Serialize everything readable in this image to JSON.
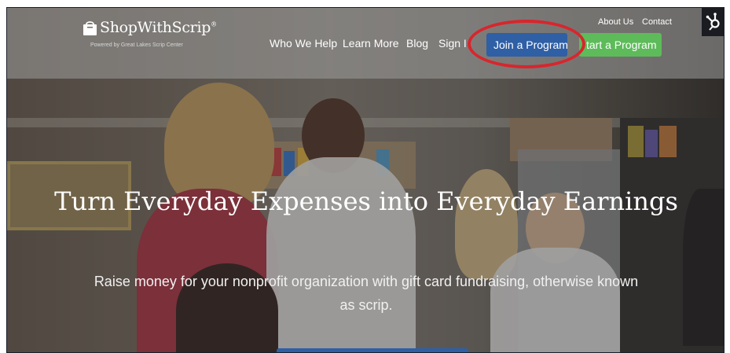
{
  "brand": {
    "name": "ShopWithScrip",
    "trademark": "®",
    "tagline": "Powered by Great Lakes Scrip Center"
  },
  "top_links": {
    "about": "About Us",
    "contact": "Contact"
  },
  "nav": {
    "who_we_help": "Who We Help",
    "learn_more": "Learn More",
    "blog": "Blog",
    "sign_in": "Sign I"
  },
  "buttons": {
    "join": "Join a Program",
    "start": "tart a Program"
  },
  "hero": {
    "title": "Turn Everyday Expenses into Everyday Earnings",
    "subtitle": "Raise money for your nonprofit organization with gift card fundraising, otherwise known as scrip."
  },
  "icons": {
    "logo": "shopping-bag-icon",
    "hub": "hubspot-sprocket-icon"
  },
  "colors": {
    "join_button": "#2f5fa5",
    "start_button": "#5dbb5a",
    "annotation": "#d9252c"
  }
}
